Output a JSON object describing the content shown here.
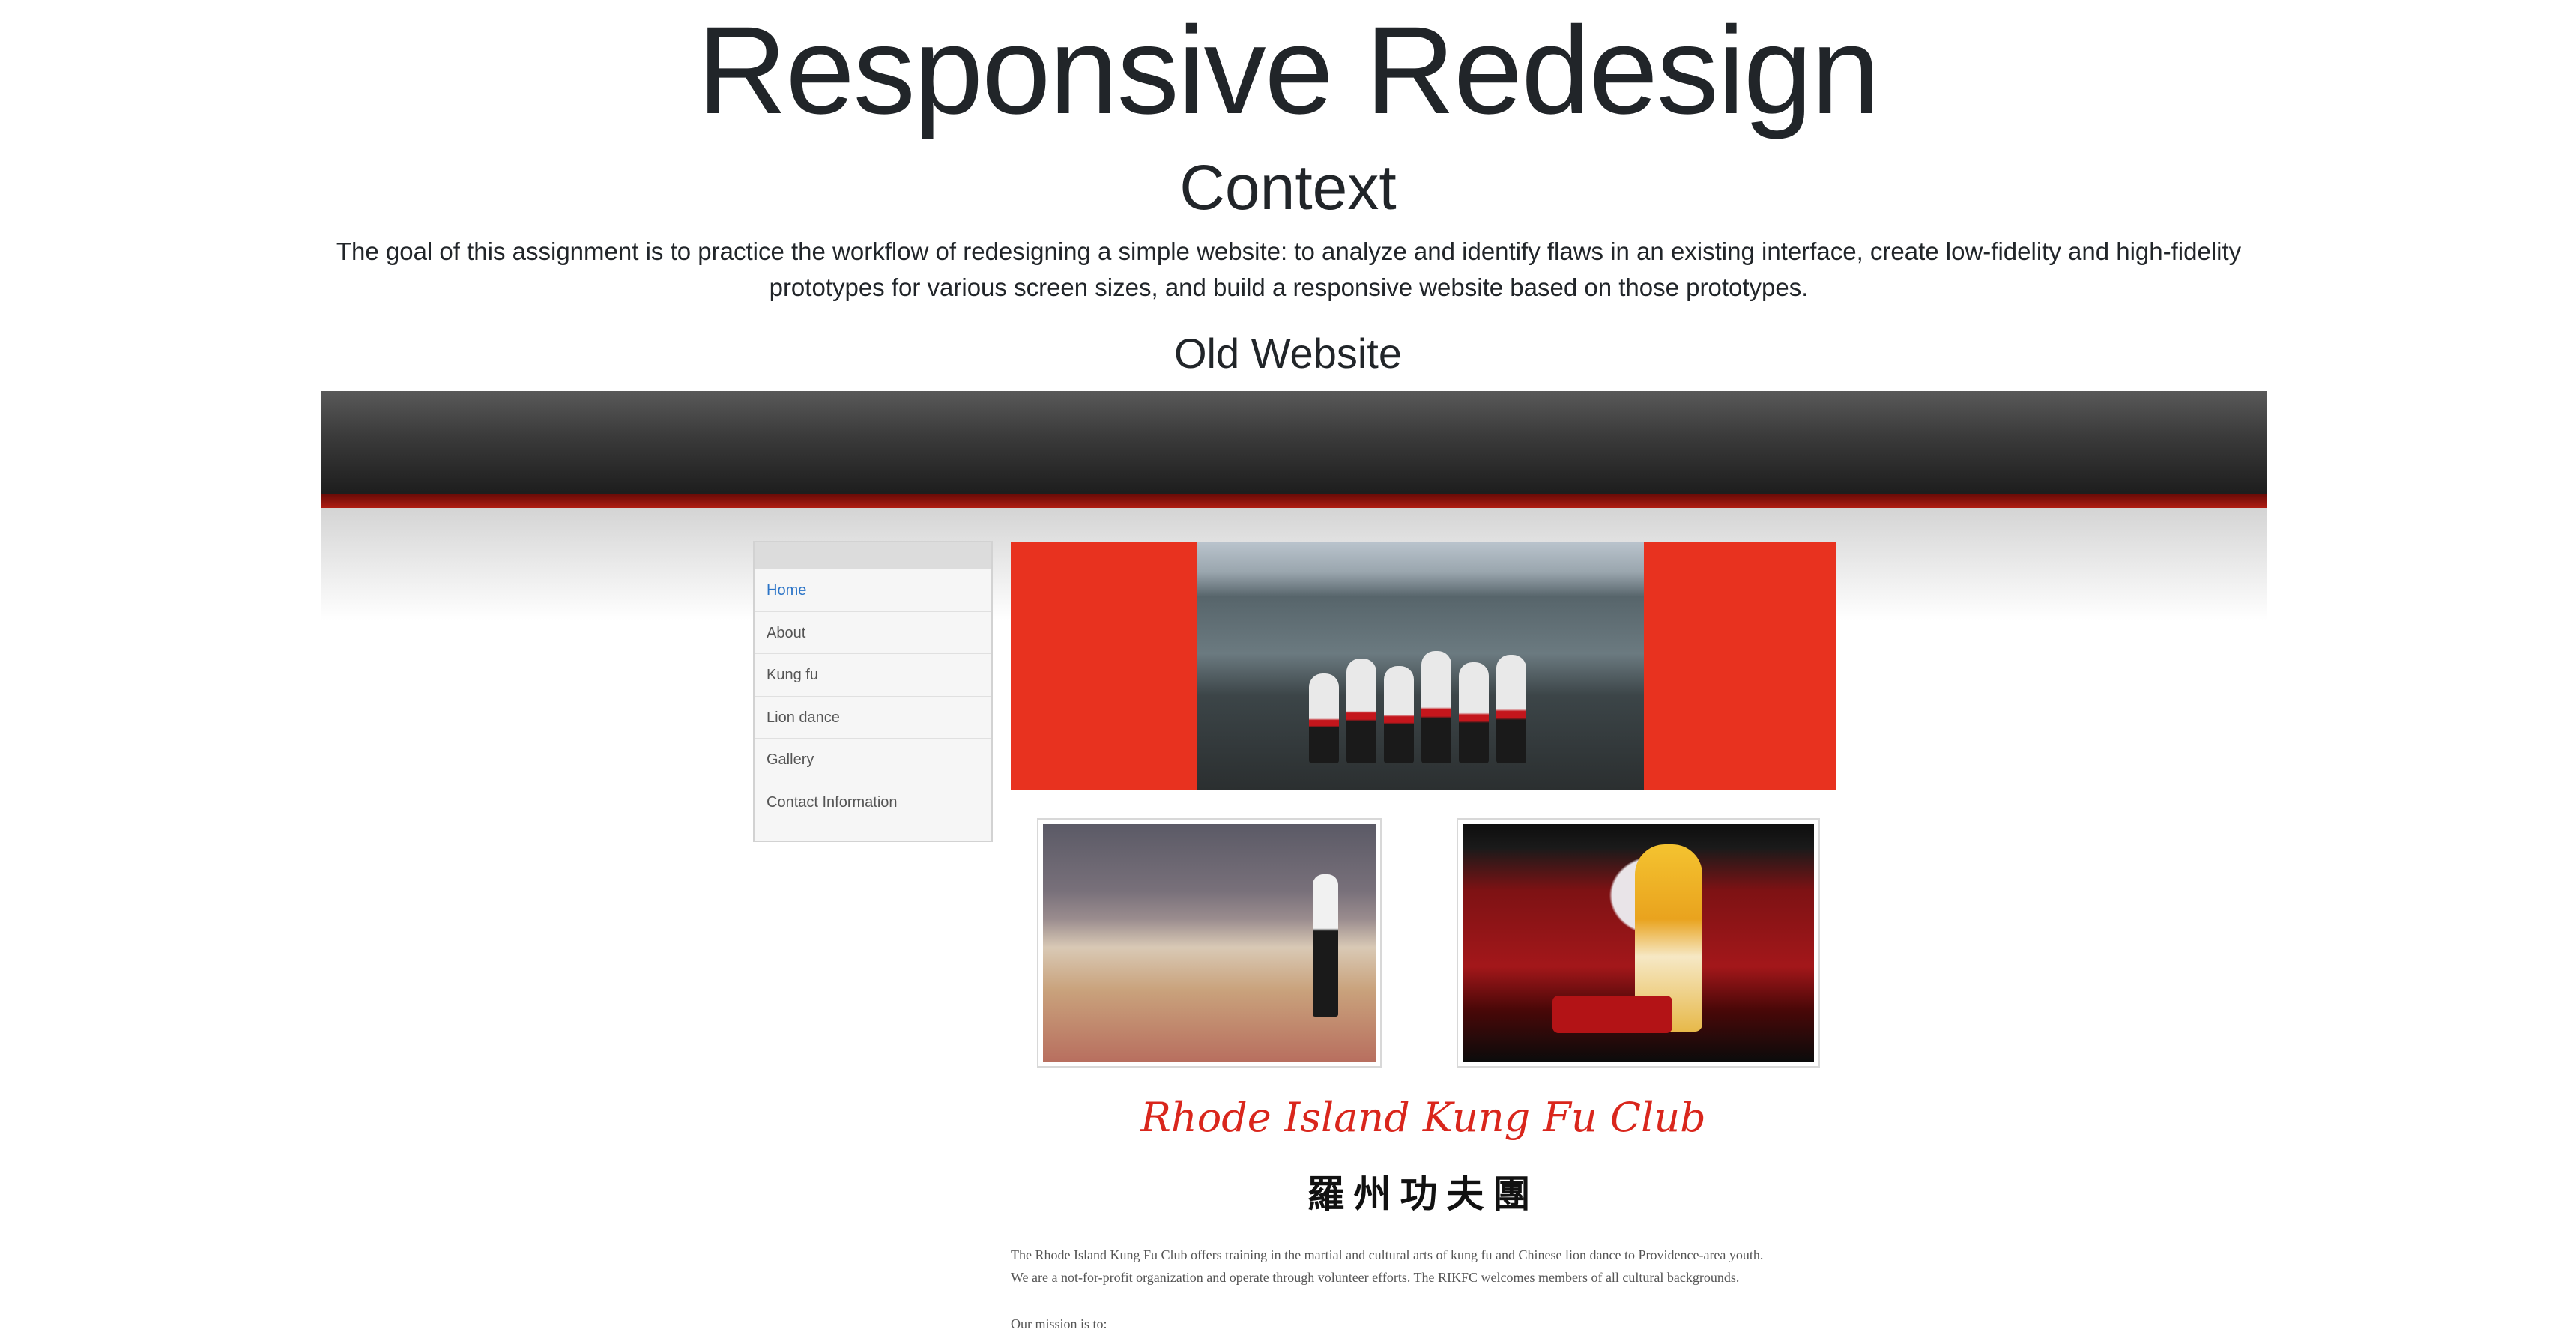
{
  "page": {
    "title": "Responsive Redesign",
    "context_heading": "Context",
    "context_text": "The goal of this assignment is to practice the workflow of redesigning a simple website: to analyze and identify flaws in an existing interface, create low-fidelity and high-fidelity prototypes for various screen sizes, and build a responsive website based on those prototypes.",
    "old_website_heading": "Old Website"
  },
  "old_site": {
    "nav": {
      "items": [
        {
          "label": "Home",
          "active": true
        },
        {
          "label": "About"
        },
        {
          "label": "Kung fu"
        },
        {
          "label": "Lion dance"
        },
        {
          "label": "Gallery"
        },
        {
          "label": "Contact Information"
        }
      ]
    },
    "club_title": "Rhode Island Kung Fu Club",
    "club_chinese": "羅州功夫團",
    "description_line1": "The Rhode Island Kung Fu Club offers training in the martial and cultural arts of kung fu and Chinese lion dance to Providence-area youth.",
    "description_line2": "We are a not-for-profit organization and operate through volunteer efforts. The RIKFC welcomes members of all cultural backgrounds.",
    "mission_intro": "Our mission is to:",
    "colors": {
      "hero_red": "#e8321f",
      "brand_red": "#d9261c",
      "nav_active": "#2b74c7"
    }
  }
}
